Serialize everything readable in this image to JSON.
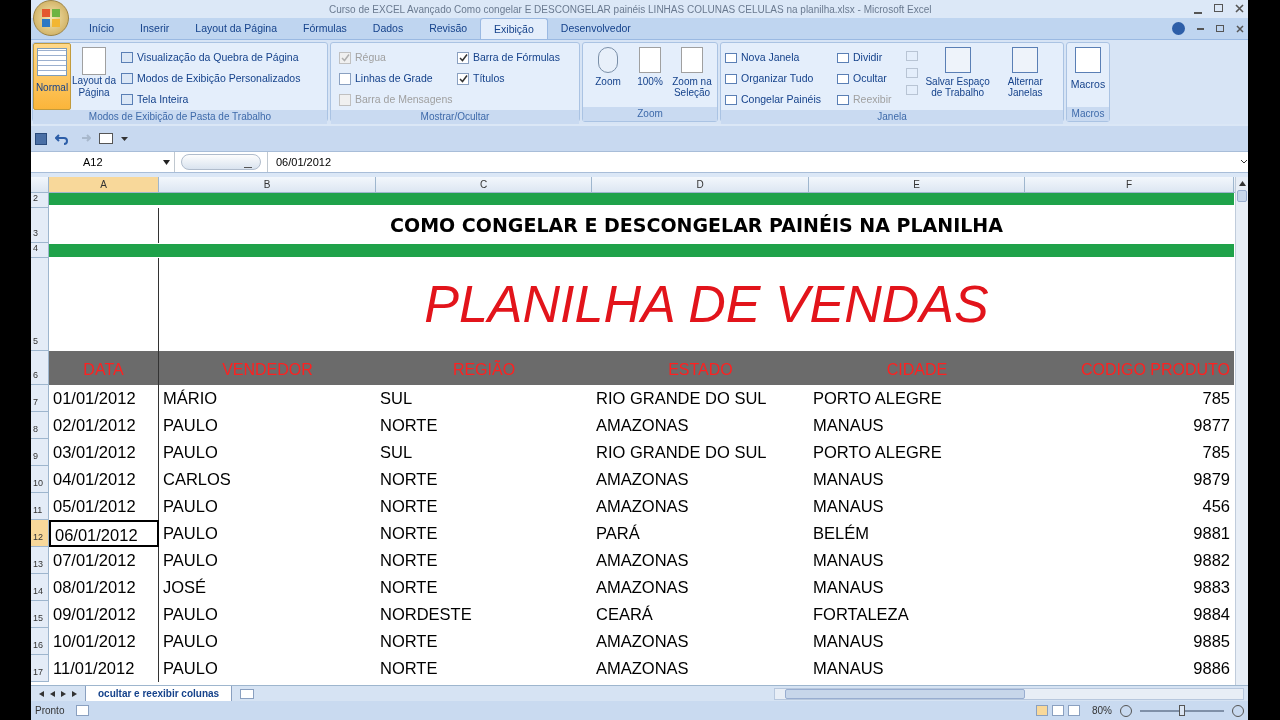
{
  "window": {
    "title": "Curso de EXCEL Avançado Como congelar E DESCONGELAR painéis LINHAS COLUNAS CELULAS na planilha.xlsx - Microsoft Excel"
  },
  "tabs": [
    {
      "label": "Início",
      "selected": false
    },
    {
      "label": "Inserir",
      "selected": false
    },
    {
      "label": "Layout da Página",
      "selected": false
    },
    {
      "label": "Fórmulas",
      "selected": false
    },
    {
      "label": "Dados",
      "selected": false
    },
    {
      "label": "Revisão",
      "selected": false
    },
    {
      "label": "Exibição",
      "selected": true
    },
    {
      "label": "Desenvolvedor",
      "selected": false
    }
  ],
  "ribbon": {
    "workbook_views": {
      "title": "Modos de Exibição de Pasta de Trabalho",
      "normal": {
        "label": "Normal",
        "selected": true
      },
      "page_layout": {
        "label": "Layout da Página",
        "selected": false
      },
      "small": [
        "Visualização da Quebra de Página",
        "Modos de Exibição Personalizados",
        "Tela Inteira"
      ]
    },
    "show_hide": {
      "title": "Mostrar/Ocultar",
      "checkboxes": [
        {
          "label": "Régua",
          "checked": true,
          "disabled": true
        },
        {
          "label": "Linhas de Grade",
          "checked": false,
          "disabled": false
        },
        {
          "label": "Barra de Mensagens",
          "checked": false,
          "disabled": true
        },
        {
          "label": "Barra de Fórmulas",
          "checked": true,
          "disabled": false
        },
        {
          "label": "Títulos",
          "checked": true,
          "disabled": false
        }
      ]
    },
    "zoom": {
      "title": "Zoom",
      "buttons": [
        "Zoom",
        "100%",
        "Zoom na Seleção"
      ]
    },
    "window_group": {
      "title": "Janela",
      "items": [
        {
          "label": "Nova Janela",
          "disabled": false
        },
        {
          "label": "Organizar Tudo",
          "disabled": false
        },
        {
          "label": "Congelar Painéis",
          "disabled": false
        },
        {
          "label": "Dividir",
          "disabled": false
        },
        {
          "label": "Ocultar",
          "disabled": false
        },
        {
          "label": "Reexibir",
          "disabled": true
        }
      ],
      "big": [
        "Salvar Espaço de Trabalho",
        "Alternar Janelas"
      ]
    },
    "macros": {
      "title": "Macros",
      "button": "Macros"
    }
  },
  "formula_bar": {
    "name_box": "A12",
    "value": "06/01/2012"
  },
  "columns": [
    "A",
    "B",
    "C",
    "D",
    "E",
    "F"
  ],
  "sheet": {
    "banner_row": "2",
    "title_row": "3",
    "title": "COMO CONGELAR E DESCONGELAR PAINÉIS NA PLANILHA",
    "banner_row2": "4",
    "heading_row": "5",
    "heading": "PLANILHA DE VENDAS",
    "header_row": "6",
    "headers": [
      "DATA",
      "VENDEDOR",
      "REGIÃO",
      "ESTADO",
      "CIDADE",
      "CODIGO PRODUTO"
    ],
    "rows": [
      {
        "num": "7",
        "selected": false,
        "cells": [
          "01/01/2012",
          "MÁRIO",
          "SUL",
          "RIO GRANDE DO SUL",
          "PORTO ALEGRE",
          "785"
        ]
      },
      {
        "num": "8",
        "selected": false,
        "cells": [
          "02/01/2012",
          "PAULO",
          "NORTE",
          "AMAZONAS",
          "MANAUS",
          "9877"
        ]
      },
      {
        "num": "9",
        "selected": false,
        "cells": [
          "03/01/2012",
          "PAULO",
          "SUL",
          "RIO GRANDE DO SUL",
          "PORTO ALEGRE",
          "785"
        ]
      },
      {
        "num": "10",
        "selected": false,
        "cells": [
          "04/01/2012",
          "CARLOS",
          "NORTE",
          "AMAZONAS",
          "MANAUS",
          "9879"
        ]
      },
      {
        "num": "11",
        "selected": false,
        "cells": [
          "05/01/2012",
          "PAULO",
          "NORTE",
          "AMAZONAS",
          "MANAUS",
          "456"
        ]
      },
      {
        "num": "12",
        "selected": true,
        "cells": [
          "06/01/2012",
          "PAULO",
          "NORTE",
          "PARÁ",
          "BELÉM",
          "9881"
        ]
      },
      {
        "num": "13",
        "selected": false,
        "cells": [
          "07/01/2012",
          "PAULO",
          "NORTE",
          "AMAZONAS",
          "MANAUS",
          "9882"
        ]
      },
      {
        "num": "14",
        "selected": false,
        "cells": [
          "08/01/2012",
          "JOSÉ",
          "NORTE",
          "AMAZONAS",
          "MANAUS",
          "9883"
        ]
      },
      {
        "num": "15",
        "selected": false,
        "cells": [
          "09/01/2012",
          "PAULO",
          "NORDESTE",
          "CEARÁ",
          "FORTALEZA",
          "9884"
        ]
      },
      {
        "num": "16",
        "selected": false,
        "cells": [
          "10/01/2012",
          "PAULO",
          "NORTE",
          "AMAZONAS",
          "MANAUS",
          "9885"
        ]
      },
      {
        "num": "17",
        "selected": false,
        "cells": [
          "11/01/2012",
          "PAULO",
          "NORTE",
          "AMAZONAS",
          "MANAUS",
          "9886"
        ]
      }
    ]
  },
  "sheet_tabs": [
    {
      "label": "ocultar e reexibir colunas",
      "selected": true
    }
  ],
  "status_bar": {
    "text": "Pronto",
    "zoom": "80%",
    "zoom_slider": {
      "level": 0.5
    }
  }
}
